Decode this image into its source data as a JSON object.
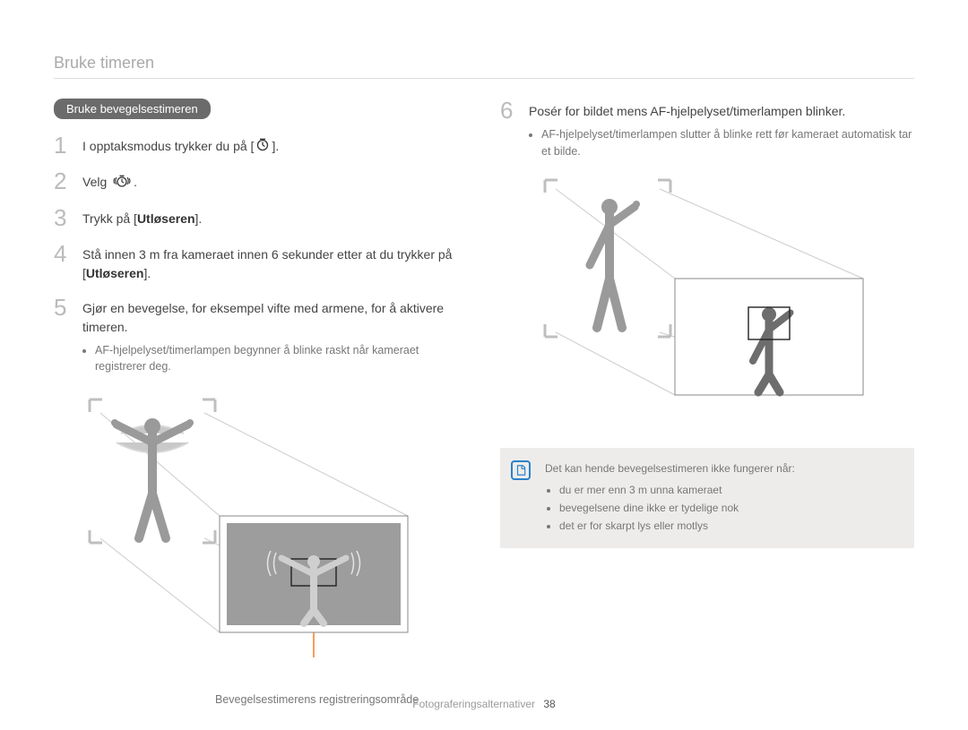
{
  "header": {
    "title": "Bruke timeren"
  },
  "left": {
    "pill": "Bruke bevegelsestimeren",
    "steps": [
      {
        "num": "1",
        "text_before": "I opptaksmodus trykker du på [",
        "text_after": "].",
        "icon": "timer"
      },
      {
        "num": "2",
        "text_before": "Velg ",
        "text_after": ".",
        "icon": "motion-timer"
      },
      {
        "num": "3",
        "html": "Trykk på [<b>Utløseren</b>]."
      },
      {
        "num": "4",
        "html": "Stå innen 3 m fra kameraet innen 6 sekunder etter at du trykker på [<b>Utløseren</b>]."
      },
      {
        "num": "5",
        "html": "Gjør en bevegelse, for eksempel vifte med armene, for å aktivere timeren.",
        "bullets": [
          "AF-hjelpelyset/timerlampen begynner å blinke raskt når kameraet registrerer deg."
        ]
      }
    ],
    "caption": "Bevegelsestimerens registreringsområde"
  },
  "right": {
    "steps": [
      {
        "num": "6",
        "html": "Posér for bildet mens AF-hjelpelyset/timerlampen blinker.",
        "bullets": [
          "AF-hjelpelyset/timerlampen slutter å blinke rett før kameraet automatisk tar et bilde."
        ]
      }
    ],
    "note": {
      "title": "Det kan hende bevegelsestimeren ikke fungerer når:",
      "bullets": [
        "du er mer enn 3 m unna kameraet",
        "bevegelsene dine ikke er tydelige nok",
        "det er for skarpt lys eller motlys"
      ]
    }
  },
  "footer": {
    "section": "Fotograferingsalternativer",
    "page": "38"
  }
}
